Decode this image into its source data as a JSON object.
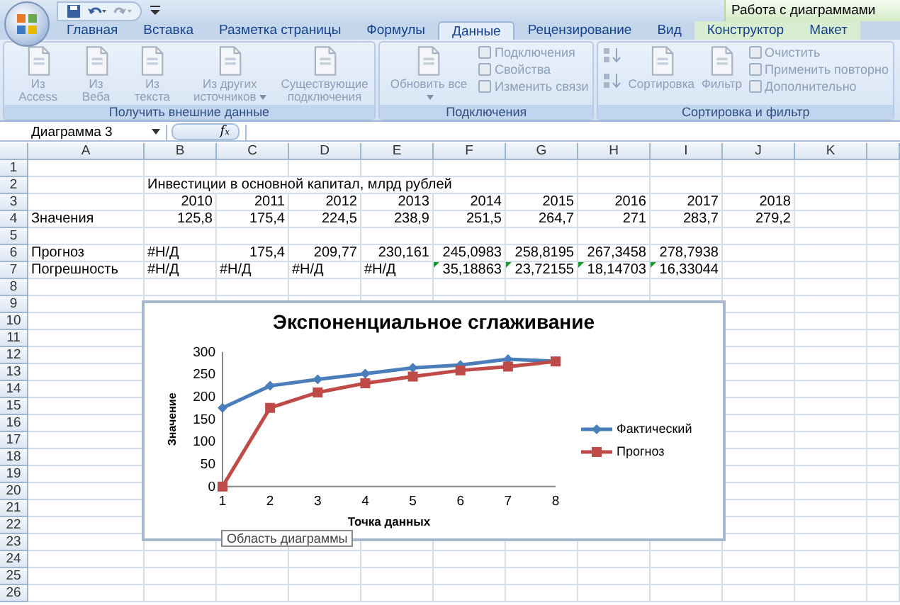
{
  "quick_access": {
    "context_title": "Работа с диаграммами"
  },
  "tabs": [
    {
      "label": "Главная",
      "selected": false,
      "contextual": false
    },
    {
      "label": "Вставка",
      "selected": false,
      "contextual": false
    },
    {
      "label": "Разметка страницы",
      "selected": false,
      "contextual": false
    },
    {
      "label": "Формулы",
      "selected": false,
      "contextual": false
    },
    {
      "label": "Данные",
      "selected": true,
      "contextual": false
    },
    {
      "label": "Рецензирование",
      "selected": false,
      "contextual": false
    },
    {
      "label": "Вид",
      "selected": false,
      "contextual": false
    },
    {
      "label": "Конструктор",
      "selected": false,
      "contextual": true
    },
    {
      "label": "Макет",
      "selected": false,
      "contextual": true
    }
  ],
  "ribbon_groups": [
    {
      "label": "Получить внешние данные",
      "items": [
        {
          "kind": "large",
          "label": "Из Access",
          "disabled": true
        },
        {
          "kind": "large",
          "label": "Из Веба",
          "disabled": true
        },
        {
          "kind": "large",
          "label": "Из текста",
          "disabled": true
        },
        {
          "kind": "large",
          "label": "Из других источников",
          "caret": true,
          "disabled": true
        },
        {
          "kind": "large",
          "label": "Существующие подключения",
          "disabled": true
        }
      ]
    },
    {
      "label": "Подключения",
      "items": [
        {
          "kind": "large",
          "label": "Обновить все",
          "caret": true,
          "disabled": true
        },
        {
          "kind": "small",
          "label": "Подключения",
          "disabled": true
        },
        {
          "kind": "small",
          "label": "Свойства",
          "disabled": true
        },
        {
          "kind": "small",
          "label": "Изменить связи",
          "disabled": true
        }
      ]
    },
    {
      "label": "Сортировка и фильтр",
      "items": [
        {
          "kind": "sortpair",
          "disabled": true
        },
        {
          "kind": "large",
          "label": "Сортировка",
          "disabled": true
        },
        {
          "kind": "large",
          "label": "Фильтр",
          "disabled": true
        },
        {
          "kind": "small",
          "label": "Очистить",
          "disabled": true
        },
        {
          "kind": "small",
          "label": "Применить повторно",
          "disabled": true
        },
        {
          "kind": "small",
          "label": "Дополнительно",
          "disabled": true
        }
      ]
    }
  ],
  "formula_bar": {
    "name_box": "Диаграмма 3",
    "function_label": "f$_{x}$"
  },
  "sheet": {
    "columns": [
      {
        "label": "A"
      },
      {
        "label": "B"
      },
      {
        "label": "C"
      },
      {
        "label": "D"
      },
      {
        "label": "E"
      },
      {
        "label": "F"
      },
      {
        "label": "G"
      },
      {
        "label": "H"
      },
      {
        "label": "I"
      },
      {
        "label": "J"
      },
      {
        "label": "K"
      }
    ],
    "rows": [
      {
        "number": "1"
      },
      {
        "number": "2",
        "cells": [
          null,
          {
            "text": "Инвестиции в основной капитал, млрд рублей"
          }
        ]
      },
      {
        "number": "3",
        "cells": [
          null,
          {
            "text": "2010",
            "kind": "number"
          },
          {
            "text": "2011",
            "kind": "number"
          },
          {
            "text": "2012",
            "kind": "number"
          },
          {
            "text": "2013",
            "kind": "number"
          },
          {
            "text": "2014",
            "kind": "number"
          },
          {
            "text": "2015",
            "kind": "number"
          },
          {
            "text": "2016",
            "kind": "number"
          },
          {
            "text": "2017",
            "kind": "number"
          },
          {
            "text": "2018",
            "kind": "number"
          }
        ]
      },
      {
        "number": "4",
        "cells": [
          {
            "text": "Значения"
          },
          {
            "text": "125,8",
            "kind": "number"
          },
          {
            "text": "175,4",
            "kind": "number"
          },
          {
            "text": "224,5",
            "kind": "number"
          },
          {
            "text": "238,9",
            "kind": "number"
          },
          {
            "text": "251,5",
            "kind": "number"
          },
          {
            "text": "264,7",
            "kind": "number"
          },
          {
            "text": "271",
            "kind": "number"
          },
          {
            "text": "283,7",
            "kind": "number"
          },
          {
            "text": "279,2",
            "kind": "number"
          }
        ]
      },
      {
        "number": "5"
      },
      {
        "number": "6",
        "cells": [
          {
            "text": "Прогноз"
          },
          {
            "text": "#Н/Д"
          },
          {
            "text": "175,4",
            "kind": "number"
          },
          {
            "text": "209,77",
            "kind": "number"
          },
          {
            "text": "230,161",
            "kind": "number"
          },
          {
            "text": "245,0983",
            "kind": "number"
          },
          {
            "text": "258,8195",
            "kind": "number"
          },
          {
            "text": "267,3458",
            "kind": "number"
          },
          {
            "text": "278,7938",
            "kind": "number"
          }
        ]
      },
      {
        "number": "7",
        "cells": [
          {
            "text": "Погрешность",
            "error_marker": false
          },
          {
            "text": "#Н/Д",
            "error_marker": false
          },
          {
            "text": "#Н/Д",
            "error_marker": false
          },
          {
            "text": "#Н/Д",
            "error_marker": false
          },
          {
            "text": "#Н/Д",
            "error_marker": false
          },
          {
            "text": "35,18863",
            "kind": "number",
            "error_marker": true
          },
          {
            "text": "23,72155",
            "kind": "number",
            "error_marker": true
          },
          {
            "text": "18,14703",
            "kind": "number",
            "error_marker": true
          },
          {
            "text": "16,33044",
            "kind": "number",
            "error_marker": true
          }
        ]
      },
      {
        "number": "8"
      },
      {
        "number": "9"
      },
      {
        "number": "10"
      },
      {
        "number": "11"
      },
      {
        "number": "12"
      },
      {
        "number": "13"
      },
      {
        "number": "14"
      },
      {
        "number": "15"
      },
      {
        "number": "16"
      },
      {
        "number": "17"
      },
      {
        "number": "18"
      },
      {
        "number": "19"
      },
      {
        "number": "20"
      },
      {
        "number": "21"
      },
      {
        "number": "22"
      },
      {
        "number": "23"
      },
      {
        "number": "24"
      },
      {
        "number": "25"
      },
      {
        "number": "26"
      }
    ]
  },
  "chart": {
    "selected": true,
    "tooltip": "Область диаграммы",
    "chart_data": {
      "type": "line",
      "title": "Экспоненциальное сглаживание",
      "xlabel": "Точка данных",
      "ylabel": "Значение",
      "x": [
        1,
        2,
        3,
        4,
        5,
        6,
        7,
        8
      ],
      "xlim": [
        1,
        8
      ],
      "ylim": [
        0,
        300
      ],
      "xticks": [
        1,
        2,
        3,
        4,
        5,
        6,
        7,
        8
      ],
      "yticks": [
        0,
        50,
        100,
        150,
        200,
        250,
        300
      ],
      "legend": "right",
      "series": [
        {
          "name": "Фактический",
          "color": "#4a7ebb",
          "marker": "diamond",
          "values": [
            175.4,
            224.5,
            238.9,
            251.5,
            264.7,
            271,
            283.7,
            279.2
          ]
        },
        {
          "name": "Прогноз",
          "color": "#be4b48",
          "marker": "square",
          "values": [
            0,
            175.4,
            209.77,
            230.161,
            245.0983,
            258.8195,
            267.3458,
            278.7938
          ]
        }
      ]
    }
  }
}
